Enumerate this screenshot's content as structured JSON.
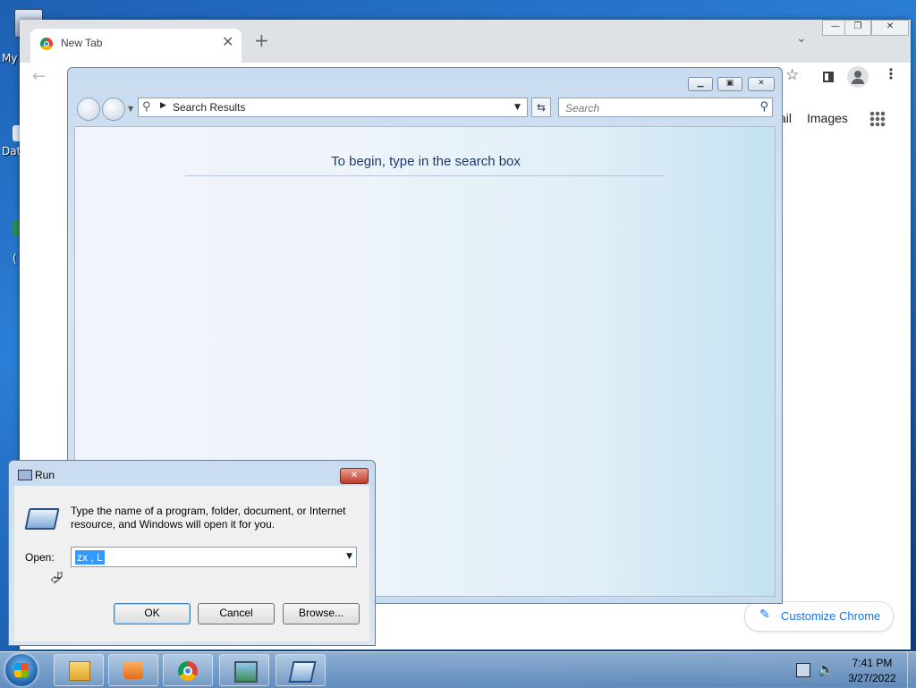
{
  "desktop": {
    "icons": [
      {
        "label": "My",
        "icon": "computer-icon"
      },
      {
        "label": "Dat",
        "icon": "database-icon"
      },
      {
        "label": "(",
        "icon": "shortcut-icon"
      }
    ]
  },
  "chrome": {
    "tab": {
      "title": "New Tab",
      "close": "✕",
      "favicon": "chrome-icon"
    },
    "new_tab": "+",
    "tab_search": "⌄",
    "window_buttons": {
      "minimize": "—",
      "maximize": "❐",
      "close": "✕"
    },
    "toolbar": {
      "back": "←",
      "star": "☆",
      "menu": "⋮"
    },
    "top_links": {
      "gmail": "ail",
      "images": "Images"
    },
    "customize_label": "Customize Chrome",
    "customize_icon": "✎"
  },
  "search_window": {
    "controls": {
      "minimize": "▁",
      "maximize": "▣",
      "close": "✕"
    },
    "address": "Search Results",
    "search_placeholder": "Search",
    "hint": "To begin, type in the search box"
  },
  "run_dialog": {
    "title": "Run",
    "close": "✕",
    "description": "Type the name of a program, folder, document, or Internet resource, and Windows will open it for you.",
    "open_label": "Open:",
    "open_value": "zx , L",
    "buttons": {
      "ok": "OK",
      "cancel": "Cancel",
      "browse": "Browse..."
    }
  },
  "taskbar": {
    "items": [
      {
        "name": "windows-explorer",
        "icon": "folder-icon"
      },
      {
        "name": "media-player",
        "icon": "media-icon"
      },
      {
        "name": "google-chrome",
        "icon": "chrome-icon"
      },
      {
        "name": "photo-viewer",
        "icon": "photo-icon"
      },
      {
        "name": "run",
        "icon": "run-icon"
      }
    ],
    "time": "7:41 PM",
    "date": "3/27/2022"
  }
}
